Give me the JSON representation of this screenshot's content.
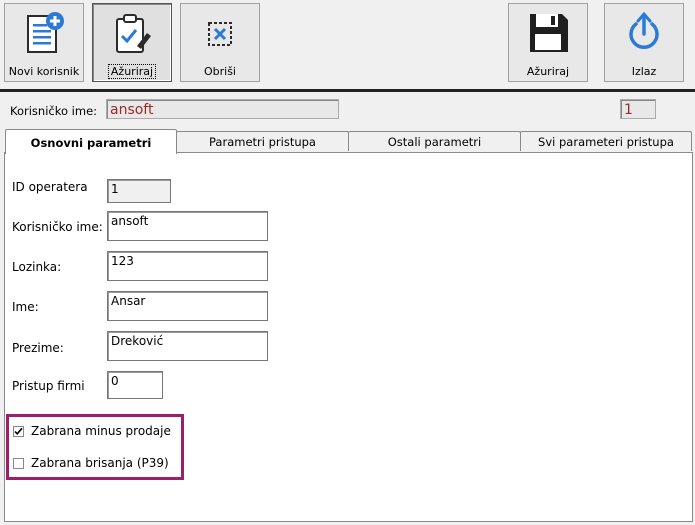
{
  "toolbar": {
    "new_user": "Novi korisnik",
    "update_left": "Ažuriraj",
    "delete": "Obriši",
    "update_right": "Ažuriraj",
    "exit": "Izlaz"
  },
  "header": {
    "username_label": "Korisničko ime:",
    "username_value": "ansoft",
    "id_value": "1"
  },
  "tabs": [
    "Osnovni parametri",
    "Parametri pristupa",
    "Ostali parametri",
    "Svi parameteri pristupa"
  ],
  "form": {
    "operator_id_label": "ID operatera",
    "operator_id_value": "1",
    "username_label": "Korisničko ime:",
    "username_value": "ansoft",
    "password_label": "Lozinka:",
    "password_value": "123",
    "firstname_label": "Ime:",
    "firstname_value": "Ansar",
    "lastname_label": "Prezime:",
    "lastname_value": "Dreković",
    "firm_access_label": "Pristup firmi",
    "firm_access_value": "0"
  },
  "checks": {
    "minus_sale_label": "Zabrana minus prodaje",
    "minus_sale_checked": true,
    "delete_label": "Zabrana brisanja (P39)",
    "delete_checked": false
  },
  "colors": {
    "accent_border": "#9c1f6a",
    "value_text": "#9a2a2a",
    "icon_blue": "#2b7bd6"
  }
}
